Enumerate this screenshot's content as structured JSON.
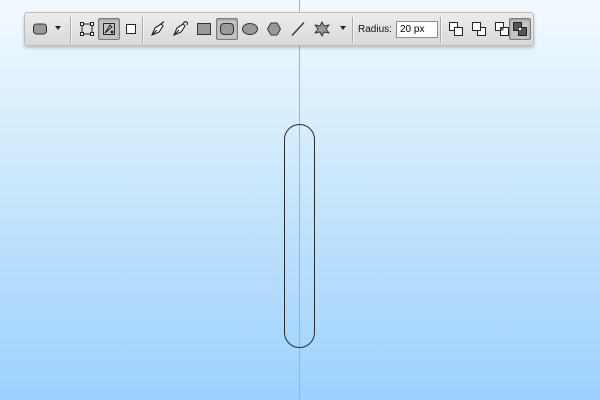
{
  "toolbar": {
    "preset_picker": {
      "icon": "rounded-rectangle-preset-icon"
    },
    "modes": [
      {
        "icon": "shape-layers-mode-icon",
        "selected": false
      },
      {
        "icon": "paths-mode-icon",
        "selected": true
      },
      {
        "icon": "fill-pixels-mode-icon",
        "selected": false
      }
    ],
    "tools": [
      {
        "icon": "pen-tool-icon",
        "selected": false
      },
      {
        "icon": "freeform-pen-tool-icon",
        "selected": false
      },
      {
        "icon": "rectangle-tool-icon",
        "selected": false
      },
      {
        "icon": "rounded-rectangle-tool-icon",
        "selected": true
      },
      {
        "icon": "ellipse-tool-icon",
        "selected": false
      },
      {
        "icon": "polygon-tool-icon",
        "selected": false
      },
      {
        "icon": "line-tool-icon",
        "selected": false
      },
      {
        "icon": "custom-shape-tool-icon",
        "selected": false
      }
    ],
    "radius_label": "Radius:",
    "radius_value": "20 px",
    "path_operations": [
      {
        "icon": "add-to-path-area-icon",
        "selected": false
      },
      {
        "icon": "subtract-from-path-area-icon",
        "selected": false
      },
      {
        "icon": "intersect-path-areas-icon",
        "selected": false
      },
      {
        "icon": "exclude-overlapping-path-areas-icon",
        "selected": true
      }
    ]
  },
  "canvas": {
    "background_top": "#f3faff",
    "background_bottom": "#9dd2fe",
    "guide_color": "#49d9e6"
  }
}
